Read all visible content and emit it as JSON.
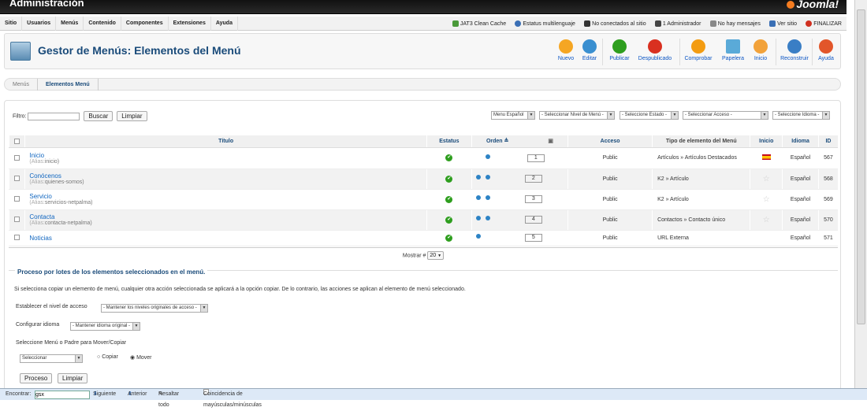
{
  "header": {
    "title": "Administración",
    "logo": "Joomla!"
  },
  "menubar": {
    "items": [
      "Sitio",
      "Usuarios",
      "Menús",
      "Contenido",
      "Componentes",
      "Extensiones",
      "Ayuda"
    ],
    "status": [
      {
        "label": "JAT3 Clean Cache",
        "icon": "cache-icon",
        "color": "#4a9a3a"
      },
      {
        "label": "Estatus multilenguaje",
        "icon": "language-icon",
        "color": "#3a6fb5"
      },
      {
        "label": "No conectados al sitio",
        "icon": "users-icon",
        "color": "#333"
      },
      {
        "label": "1 Administrador",
        "icon": "admin-icon",
        "color": "#444"
      },
      {
        "label": "No hay mensajes",
        "icon": "mail-icon",
        "color": "#888"
      },
      {
        "label": "Ver sitio",
        "icon": "site-icon",
        "color": "#3a6fb5"
      },
      {
        "label": "FINALIZAR",
        "icon": "logout-icon",
        "color": "#d03020"
      }
    ]
  },
  "toolbar": {
    "title": "Gestor de Menús: Elementos del Menú",
    "buttons": [
      {
        "label": "Nuevo",
        "color": "#f5a623"
      },
      {
        "label": "Editar",
        "color": "#3a8fd0"
      },
      {
        "label": "Publicar",
        "color": "#2e9e1e"
      },
      {
        "label": "Despublicado",
        "color": "#d93020"
      },
      {
        "label": "Comprobar",
        "color": "#f39c12"
      },
      {
        "label": "Papelera",
        "color": "#5aaad8"
      },
      {
        "label": "Inicio",
        "color": "#f2a23a"
      },
      {
        "label": "Reconstruir",
        "color": "#3a7ec5"
      },
      {
        "label": "Ayuda",
        "color": "#e2562a"
      }
    ]
  },
  "submenu": {
    "tab1": "Menús",
    "tab2": "Elementos Menú"
  },
  "filter": {
    "label": "Filtro:",
    "value": "",
    "search": "Buscar",
    "clear": "Limpiar",
    "selects": [
      "Menu Español",
      "- Seleccionar Nivel de Menú -",
      "- Seleccione Estado -",
      "- Seleccionar Acceso -",
      "- Seleccione Idioma -"
    ]
  },
  "table": {
    "headers": {
      "title": "Título",
      "status": "Estatus",
      "order": "Orden",
      "access": "Acceso",
      "type": "Tipo de elemento del Menú",
      "home": "Inicio",
      "lang": "Idioma",
      "id": "ID"
    },
    "alias_label": "(Alias:",
    "rows": [
      {
        "title": "Inicio",
        "alias": "inicio)",
        "order": "1",
        "access": "Public",
        "type": "Artículos » Artículos Destacados",
        "lang": "Español",
        "id": "567"
      },
      {
        "title": "Conócenos",
        "alias": "quienes-somos)",
        "order": "2",
        "access": "Public",
        "type": "K2 » Artículo",
        "lang": "Español",
        "id": "568"
      },
      {
        "title": "Servicio",
        "alias": "servicios-netpalma)",
        "order": "3",
        "access": "Public",
        "type": "K2 » Artículo",
        "lang": "Español",
        "id": "569"
      },
      {
        "title": "Contacta",
        "alias": "contacta-netpalma)",
        "order": "4",
        "access": "Public",
        "type": "Contactos » Contacto único",
        "lang": "Español",
        "id": "570"
      },
      {
        "title": "Noticias",
        "alias": "",
        "order": "5",
        "access": "Public",
        "type": "URL Externa",
        "lang": "Español",
        "id": "571"
      }
    ],
    "show_label": "Mostrar #",
    "show_value": "20"
  },
  "batch": {
    "legend": "Proceso por lotes de los elementos seleccionados en el menú.",
    "desc": "Si selecciona copiar un elemento de menú, cualquier otra acción seleccionada se aplicará a la opción copiar. De lo contrario, las acciones se aplican al elemento de menú seleccionado.",
    "access_label": "Establecer el nivel de acceso",
    "access_value": "- Mantener los niveles originales de acceso -",
    "lang_label": "Configurar idioma",
    "lang_value": "- Mantener idioma original -",
    "move_label": "Seleccione Menú o Padre para Mover/Copiar",
    "move_value": "Seleccionar",
    "copy": "Copiar",
    "move": "Mover",
    "process": "Proceso",
    "clear": "Limpiar"
  },
  "findbar": {
    "label": "Encontrar:",
    "value": "gsx",
    "next": "Siguiente",
    "prev": "Anterior",
    "highlight": "Resaltar todo",
    "case": "Coincidencia de mayúsculas/minúsculas"
  }
}
